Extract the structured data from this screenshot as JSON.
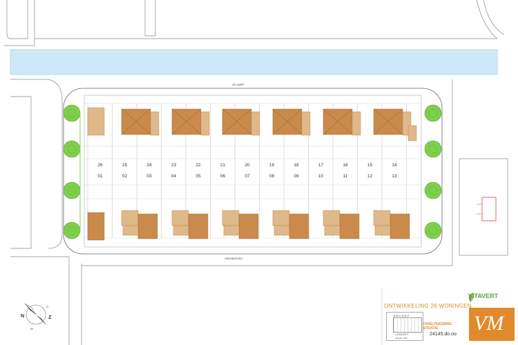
{
  "plan": {
    "street_top": "DE VAART",
    "street_bottom": "CROONHOVEN",
    "lots_top": [
      "26",
      "25",
      "24",
      "23",
      "22",
      "21",
      "20",
      "19",
      "18",
      "17",
      "16",
      "15",
      "14"
    ],
    "lots_bottom": [
      "01",
      "02",
      "03",
      "04",
      "05",
      "06",
      "07",
      "08",
      "09",
      "10",
      "11",
      "12",
      "13"
    ]
  },
  "compass": {
    "n": "N",
    "e": "O",
    "s": "Z",
    "w": "W"
  },
  "title_block": {
    "project_title": "ONTWIKKELING 26 WONINGEN",
    "drawing_title_line1": "KAVELTEKENING",
    "drawing_title_line2": "SITUATIE",
    "drawing_number": "24145.do.oo",
    "letters": "ABCDEF",
    "stage": "CONCEPT",
    "scale": "Schaal 1:250"
  },
  "logos": {
    "developer": "VITAVERT",
    "architect_mark": "VM"
  },
  "colors": {
    "water": "#cde9f8",
    "roof_dark": "#c98a4b",
    "roof_light": "#e0b98a",
    "tree": "#7ed04a",
    "accent": "#e08a2a",
    "annex": "#d8443c"
  }
}
